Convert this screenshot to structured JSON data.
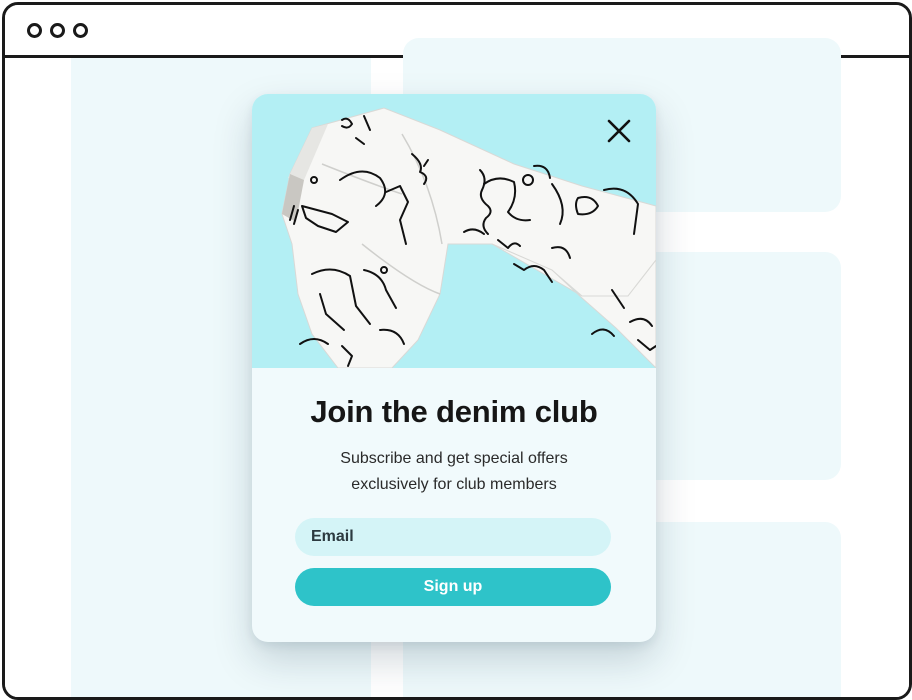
{
  "window": {
    "controls": [
      "window-dot",
      "window-dot",
      "window-dot"
    ]
  },
  "modal": {
    "image_alt": "white denim jeans with black line-art drawings",
    "close_icon": "close-icon",
    "title": "Join the denim club",
    "subtitle_line1": "Subscribe and get special offers",
    "subtitle_line2": "exclusively for club members",
    "email_placeholder": "Email",
    "signup_label": "Sign up"
  },
  "colors": {
    "hero_bg": "#b3eff4",
    "modal_bg": "#f1fafc",
    "input_bg": "#d4f4f7",
    "button_bg": "#2ec3c9",
    "page_bg_blocks": "#eef9fb",
    "frame": "#1a1a1a"
  }
}
